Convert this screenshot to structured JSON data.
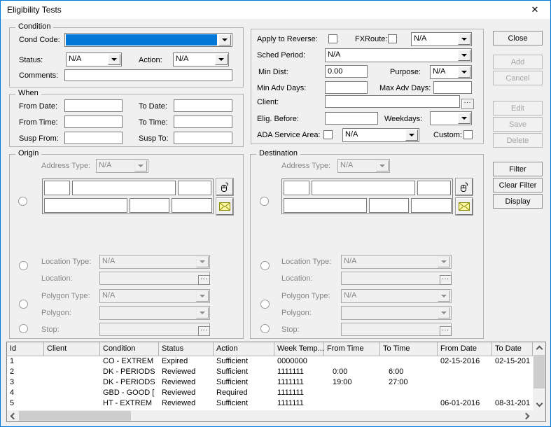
{
  "window": {
    "title": "Eligibility Tests",
    "close_glyph": "✕"
  },
  "condition": {
    "group_label": "Condition",
    "cond_code_label": "Cond Code:",
    "cond_code_value": "",
    "status_label": "Status:",
    "status_value": "N/A",
    "action_label": "Action:",
    "action_value": "N/A",
    "comments_label": "Comments:",
    "comments_value": ""
  },
  "options": {
    "apply_to_reverse_label": "Apply to Reverse:",
    "fxroute_label": "FXRoute:",
    "fxroute_value": "N/A",
    "sched_period_label": "Sched Period:",
    "sched_period_value": "N/A",
    "min_dist_label": "Min Dist:",
    "min_dist_value": "0.00",
    "purpose_label": "Purpose:",
    "purpose_value": "N/A",
    "min_adv_days_label": "Min Adv Days:",
    "min_adv_days_value": "",
    "max_adv_days_label": "Max Adv Days:",
    "max_adv_days_value": "",
    "client_label": "Client:",
    "client_value": "",
    "elig_before_label": "Elig. Before:",
    "elig_before_value": "",
    "weekdays_label": "Weekdays:",
    "weekdays_value": "",
    "ada_service_area_label": "ADA Service Area:",
    "ada_value": "N/A",
    "custom_label": "Custom:"
  },
  "when": {
    "group_label": "When",
    "from_date_label": "From Date:",
    "from_date_value": "",
    "to_date_label": "To Date:",
    "to_date_value": "",
    "from_time_label": "From Time:",
    "from_time_value": "",
    "to_time_label": "To Time:",
    "to_time_value": "",
    "susp_from_label": "Susp From:",
    "susp_from_value": "",
    "susp_to_label": "Susp To:",
    "susp_to_value": ""
  },
  "origin": {
    "group_label": "Origin",
    "address_type_label": "Address Type:",
    "address_type_value": "N/A",
    "location_type_label": "Location Type:",
    "location_type_value": "N/A",
    "location_label": "Location:",
    "location_value": "",
    "polygon_type_label": "Polygon Type:",
    "polygon_type_value": "N/A",
    "polygon_label": "Polygon:",
    "polygon_value": "",
    "stop_label": "Stop:",
    "stop_value": ""
  },
  "destination": {
    "group_label": "Destination",
    "address_type_label": "Address Type:",
    "address_type_value": "N/A",
    "location_type_label": "Location Type:",
    "location_type_value": "N/A",
    "location_label": "Location:",
    "location_value": "",
    "polygon_type_label": "Polygon Type:",
    "polygon_type_value": "N/A",
    "polygon_label": "Polygon:",
    "polygon_value": "",
    "stop_label": "Stop:",
    "stop_value": ""
  },
  "side_buttons": [
    {
      "label": "Close",
      "enabled": true
    },
    {
      "label": "Add",
      "enabled": false
    },
    {
      "label": "Cancel",
      "enabled": false
    },
    {
      "label": "Edit",
      "enabled": false
    },
    {
      "label": "Save",
      "enabled": false
    },
    {
      "label": "Delete",
      "enabled": false
    },
    {
      "label": "Filter",
      "enabled": true
    },
    {
      "label": "Clear Filter",
      "enabled": true
    },
    {
      "label": "Display",
      "enabled": true
    }
  ],
  "glyphs": {
    "ellipsis": "...",
    "mouse_icon": "map-pick-mouse-icon",
    "envelope_icon": "mail-envelope-icon"
  },
  "table": {
    "columns": [
      "Id",
      "Client",
      "Condition",
      "Status",
      "Action",
      "Week Temp...",
      "From Time",
      "To Time",
      "From Date",
      "To Date"
    ],
    "rows": [
      [
        "1",
        "",
        "CO - EXTREM",
        "Expired",
        "Sufficient",
        "0000000",
        "",
        "",
        "02-15-2016",
        "02-15-201"
      ],
      [
        "2",
        "",
        "DK - PERIODS",
        "Reviewed",
        "Sufficient",
        "1111111",
        "0:00",
        "6:00",
        "",
        ""
      ],
      [
        "3",
        "",
        "DK - PERIODS",
        "Reviewed",
        "Sufficient",
        "1111111",
        "19:00",
        "27:00",
        "",
        ""
      ],
      [
        "4",
        "",
        "GBD - GOOD [",
        "Reviewed",
        "Required",
        "1111111",
        "",
        "",
        "",
        ""
      ],
      [
        "5",
        "",
        "HT - EXTREM",
        "Reviewed",
        "Sufficient",
        "1111111",
        "",
        "",
        "06-01-2016",
        "08-31-201"
      ]
    ]
  },
  "colors": {
    "selection_blue": "#0078d7",
    "window_border": "#0078d7",
    "dialog_bg": "#f0f0f0",
    "envelope_yellow": "#fdf6a3"
  }
}
